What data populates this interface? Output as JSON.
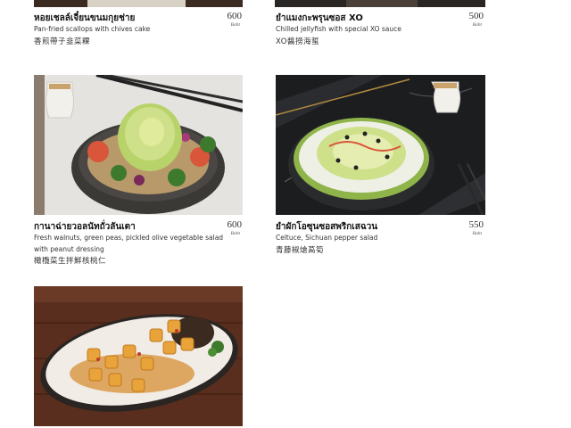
{
  "menu_items": [
    {
      "thai": "หอยเชลล์เจี๋ยนขนมกุยช่าย",
      "english": [
        "Pan-fried scallops with chives cake"
      ],
      "chinese": "香煎帶子韭菜粿",
      "price": "600",
      "currency": "Baht"
    },
    {
      "thai": "ยำแมงกะพรุนซอส XO",
      "english": [
        "Chilled jellyfish with special XO sauce"
      ],
      "chinese": "XO醬撈海蜇",
      "price": "500",
      "currency": "Baht"
    },
    {
      "thai": "กานาฉ่ายวอลนัทถั่วลันเตา",
      "english": [
        "Fresh walnuts, green peas, pickled olive vegetable salad",
        "with peanut dressing"
      ],
      "chinese": "橄欖菜生拌鮮核桃仁",
      "price": "600",
      "currency": "Baht"
    },
    {
      "thai": "ยำผักโอซุนซอสพริกเสฉวน",
      "english": [
        "Celtuce, Sichuan pepper salad"
      ],
      "chinese": "青藤椒熗萵筍",
      "price": "550",
      "currency": "Baht"
    }
  ],
  "photos": [
    {
      "name": "walnut-salad-photo",
      "subject": "walnut and green pea salad in dark bowl"
    },
    {
      "name": "celtuce-salad-photo",
      "subject": "celtuce salad on dark marble"
    },
    {
      "name": "tofu-dish-photo",
      "subject": "fried tofu with crispy noodles on plate"
    }
  ],
  "colors": {
    "background": "#ffffff",
    "text": "#222222"
  }
}
